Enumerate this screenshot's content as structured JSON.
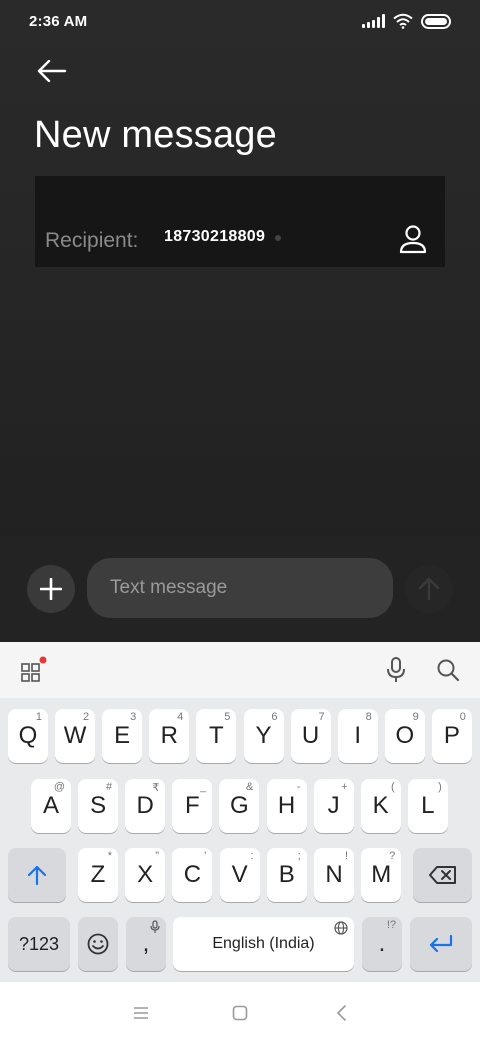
{
  "status_bar": {
    "time": "2:36 AM",
    "icons": [
      "signal-icon",
      "wifi-icon",
      "battery-icon"
    ]
  },
  "header": {
    "back_icon": "back-arrow-icon",
    "title": "New message"
  },
  "recipient": {
    "label": "Recipient:",
    "value": "18730218809",
    "contact_icon": "contact-person-icon"
  },
  "compose": {
    "add_icon": "plus-icon",
    "placeholder": "Text message",
    "send_icon": "send-arrow-up-icon"
  },
  "keyboard": {
    "toolbar": {
      "apps_icon": "apps-grid-icon",
      "mic_icon": "mic-icon",
      "search_icon": "search-icon"
    },
    "row1": [
      {
        "label": "Q",
        "hint": "1"
      },
      {
        "label": "W",
        "hint": "2"
      },
      {
        "label": "E",
        "hint": "3"
      },
      {
        "label": "R",
        "hint": "4"
      },
      {
        "label": "T",
        "hint": "5"
      },
      {
        "label": "Y",
        "hint": "6"
      },
      {
        "label": "U",
        "hint": "7"
      },
      {
        "label": "I",
        "hint": "8"
      },
      {
        "label": "O",
        "hint": "9"
      },
      {
        "label": "P",
        "hint": "0"
      }
    ],
    "row2": [
      {
        "label": "A",
        "hint": "@"
      },
      {
        "label": "S",
        "hint": "#"
      },
      {
        "label": "D",
        "hint": "₹"
      },
      {
        "label": "F",
        "hint": "_"
      },
      {
        "label": "G",
        "hint": "&"
      },
      {
        "label": "H",
        "hint": "-"
      },
      {
        "label": "J",
        "hint": "+"
      },
      {
        "label": "K",
        "hint": "("
      },
      {
        "label": "L",
        "hint": ")"
      }
    ],
    "row3": [
      {
        "label": "Z",
        "hint": "*"
      },
      {
        "label": "X",
        "hint": "\""
      },
      {
        "label": "C",
        "hint": "'"
      },
      {
        "label": "V",
        "hint": ":"
      },
      {
        "label": "B",
        "hint": ";"
      },
      {
        "label": "N",
        "hint": "!"
      },
      {
        "label": "M",
        "hint": "?"
      }
    ],
    "shift_icon": "shift-arrow-icon",
    "backspace_icon": "backspace-icon",
    "symbols_label": "?123",
    "emoji_icon": "emoji-icon",
    "comma_label": ",",
    "space_label": "English (India)",
    "period_label": ".",
    "period_hint": "!?",
    "enter_icon": "enter-icon",
    "accent_color": "#1a73e8"
  },
  "nav_bar": {
    "icons": [
      "menu-icon",
      "home-square-icon",
      "back-chevron-icon"
    ]
  }
}
